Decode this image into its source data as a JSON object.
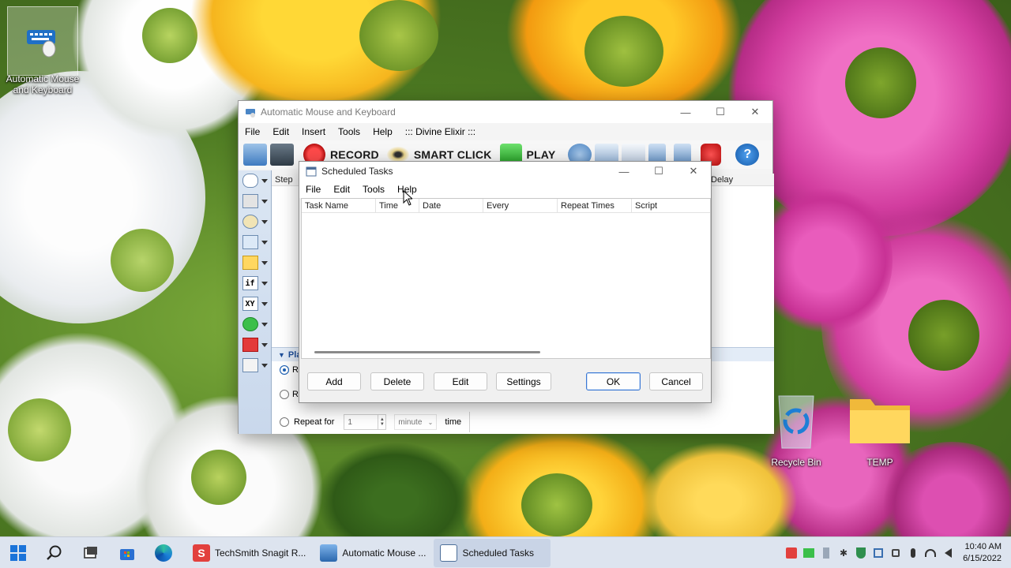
{
  "desktop": {
    "icons": [
      {
        "label": "Automatic Mouse and Keyboard"
      },
      {
        "label": "Recycle Bin"
      },
      {
        "label": "TEMP"
      }
    ]
  },
  "main_window": {
    "title": "Automatic Mouse and Keyboard",
    "menu": [
      "File",
      "Edit",
      "Insert",
      "Tools",
      "Help",
      "::: Divine Elixir :::"
    ],
    "toolbar": {
      "record": "RECORD",
      "smart_click": "SMART CLICK",
      "play": "PLAY"
    },
    "list_headers": {
      "step": "Step",
      "delay": "Delay"
    },
    "play_section": "Play",
    "options": {
      "repeat_label_1": "Re",
      "repeat_label_2": "Re",
      "repeat_for_label": "Repeat for",
      "repeat_for_value": "1",
      "repeat_unit": "minute",
      "time_label": "time"
    }
  },
  "dialog": {
    "title": "Scheduled Tasks",
    "menu": [
      "File",
      "Edit",
      "Tools",
      "Help"
    ],
    "columns": [
      "Task Name",
      "Time",
      "Date",
      "Every",
      "Repeat Times",
      "Script"
    ],
    "rows": [],
    "buttons": {
      "add": "Add",
      "delete": "Delete",
      "edit": "Edit",
      "settings": "Settings",
      "ok": "OK",
      "cancel": "Cancel"
    }
  },
  "taskbar": {
    "tasks": [
      {
        "label": "TechSmith Snagit R...",
        "active": false
      },
      {
        "label": "Automatic Mouse ...",
        "active": false
      },
      {
        "label": "Scheduled Tasks",
        "active": true
      }
    ],
    "clock": {
      "time": "10:40 AM",
      "date": "6/15/2022"
    }
  },
  "colors": {
    "accent": "#3a78d4",
    "taskbar": "#dde4ef",
    "record_red": "#d81e1e",
    "play_green": "#2fb52f"
  }
}
